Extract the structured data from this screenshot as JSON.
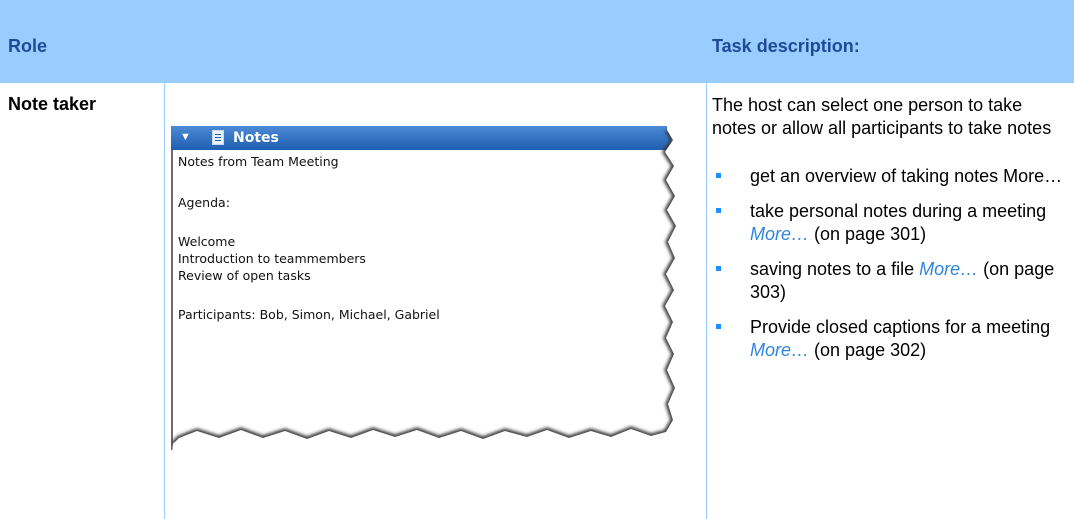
{
  "header": {
    "role_label": "Role",
    "task_label": "Task description:"
  },
  "role": {
    "name": "Note taker"
  },
  "notes_panel": {
    "title": "Notes",
    "icons": {
      "collapse": "chevron-down-icon",
      "notes": "notebook-icon"
    },
    "lines": [
      "Notes from Team Meeting",
      "Agenda:",
      "Welcome",
      "Introduction to teammembers",
      "Review of open tasks",
      "Participants: Bob, Simon, Michael, Gabriel"
    ]
  },
  "task": {
    "intro": "The host can select one person to take notes or allow all participants to take notes",
    "items": [
      {
        "text": "get an overview of taking notes",
        "more": "More…",
        "page": ""
      },
      {
        "text": "take personal notes during a meeting",
        "more": "More…",
        "page": "(on page 301)"
      },
      {
        "text": "saving notes to a file",
        "more": "More…",
        "page": "(on page 303)"
      },
      {
        "text": "Provide closed captions for a meeting",
        "more": "More…",
        "page": "(on page 302)"
      }
    ]
  },
  "colors": {
    "header_bg": "#99ccff",
    "header_text": "#1f4a96",
    "link": "#2e86de",
    "bullet": "#1e90ff"
  }
}
